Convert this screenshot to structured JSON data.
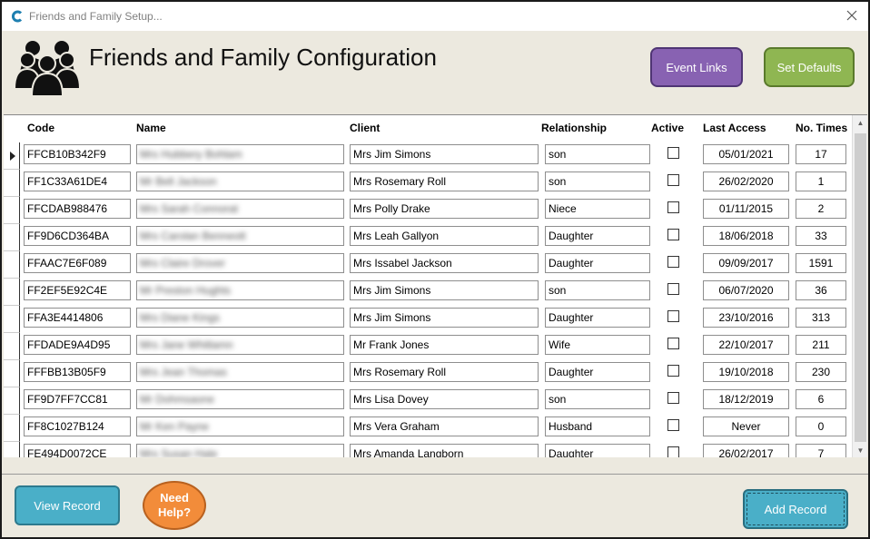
{
  "window": {
    "title": "Friends and Family Setup..."
  },
  "header": {
    "title": "Friends and Family Configuration",
    "event_links_label": "Event Links",
    "set_defaults_label": "Set Defaults"
  },
  "grid": {
    "columns": {
      "code": "Code",
      "name": "Name",
      "client": "Client",
      "relationship": "Relationship",
      "active": "Active",
      "last_access": "Last Access",
      "no_times": "No. Times"
    },
    "rows": [
      {
        "code": "FFCB10B342F9",
        "name": "Mrs Hubbery Bohlam",
        "client": "Mrs Jim Simons",
        "relationship": "son",
        "active": false,
        "last_access": "05/01/2021",
        "no_times": "17"
      },
      {
        "code": "FF1C33A61DE4",
        "name": "Mr Bell Jackson",
        "client": "Mrs Rosemary Roll",
        "relationship": "son",
        "active": false,
        "last_access": "26/02/2020",
        "no_times": "1"
      },
      {
        "code": "FFCDAB988476",
        "name": "Mrs Sarah Connorat",
        "client": "Mrs Polly Drake",
        "relationship": "Niece",
        "active": false,
        "last_access": "01/11/2015",
        "no_times": "2"
      },
      {
        "code": "FF9D6CD364BA",
        "name": "Mrs Carolan Benneott",
        "client": "Mrs Leah Gallyon",
        "relationship": "Daughter",
        "active": false,
        "last_access": "18/06/2018",
        "no_times": "33"
      },
      {
        "code": "FFAAC7E6F089",
        "name": "Mrs Claire Drover",
        "client": "Mrs Issabel Jackson",
        "relationship": "Daughter",
        "active": false,
        "last_access": "09/09/2017",
        "no_times": "1591"
      },
      {
        "code": "FF2EF5E92C4E",
        "name": "Mr Preston Hughts",
        "client": "Mrs Jim Simons",
        "relationship": "son",
        "active": false,
        "last_access": "06/07/2020",
        "no_times": "36"
      },
      {
        "code": "FFA3E4414806",
        "name": "Mrs Diane Kings",
        "client": "Mrs Jim Simons",
        "relationship": "Daughter",
        "active": false,
        "last_access": "23/10/2016",
        "no_times": "313"
      },
      {
        "code": "FFDADE9A4D95",
        "name": "Mrs Jane Whitlamn",
        "client": "Mr Frank Jones",
        "relationship": "Wife",
        "active": false,
        "last_access": "22/10/2017",
        "no_times": "211"
      },
      {
        "code": "FFFBB13B05F9",
        "name": "Mrs Jean Thomas",
        "client": "Mrs Rosemary Roll",
        "relationship": "Daughter",
        "active": false,
        "last_access": "19/10/2018",
        "no_times": "230"
      },
      {
        "code": "FF9D7FF7CC81",
        "name": "Mr Dohmsaone",
        "client": "Mrs Lisa Dovey",
        "relationship": "son",
        "active": false,
        "last_access": "18/12/2019",
        "no_times": "6"
      },
      {
        "code": "FF8C1027B124",
        "name": "Mr Ken Payne",
        "client": "Mrs Vera Graham",
        "relationship": "Husband",
        "active": false,
        "last_access": "Never",
        "no_times": "0"
      },
      {
        "code": "FE494D0072CE",
        "name": "Mrs Susan Hale",
        "client": "Mrs Amanda Langborn",
        "relationship": "Daughter",
        "active": false,
        "last_access": "26/02/2017",
        "no_times": "7"
      }
    ]
  },
  "footer": {
    "view_record_label": "View Record",
    "need_help_line1": "Need",
    "need_help_line2": "Help?",
    "add_record_label": "Add Record"
  },
  "colors": {
    "event_links": "#8862b2",
    "set_defaults": "#8fb652",
    "primary_button": "#4aafc8",
    "help_button": "#f28c3a",
    "background": "#ece9df"
  }
}
